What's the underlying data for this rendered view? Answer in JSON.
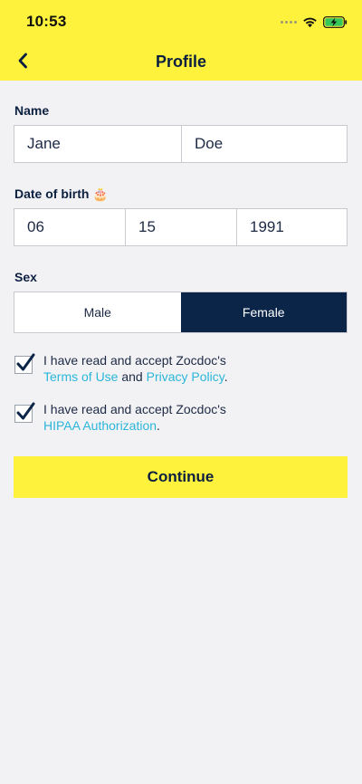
{
  "status_bar": {
    "time": "10:53"
  },
  "header": {
    "title": "Profile",
    "back_icon": "chevron-left-icon"
  },
  "name": {
    "label": "Name",
    "first": "Jane",
    "last": "Doe"
  },
  "dob": {
    "label": "Date of birth",
    "emoji": "🎂",
    "month": "06",
    "day": "15",
    "year": "1991"
  },
  "sex": {
    "label": "Sex",
    "options": [
      "Male",
      "Female"
    ],
    "selected": "Female"
  },
  "agreements": [
    {
      "checked": true,
      "prefix": "I have read and accept Zocdoc's",
      "link1": "Terms of Use",
      "middle": "and",
      "link2": "Privacy Policy",
      "suffix": "."
    },
    {
      "checked": true,
      "prefix": "I have read and accept Zocdoc's",
      "link1": "HIPAA Authorization",
      "suffix": "."
    }
  ],
  "continue_label": "Continue",
  "colors": {
    "header_bg": "#fff23d",
    "navy": "#0b2548",
    "link": "#2bb6d9",
    "page_bg": "#f2f2f5"
  }
}
